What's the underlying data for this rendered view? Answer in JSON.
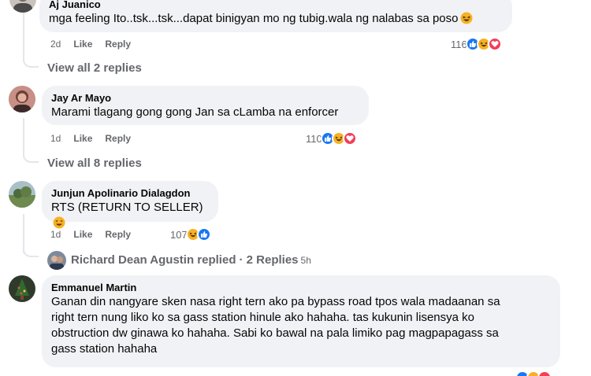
{
  "comments": [
    {
      "author": "Aj Juanico",
      "text": "mga feeling Ito..tsk...tsk...dapat binigyan mo ng tubig.wala ng nalabas sa poso",
      "time": "2d",
      "like_label": "Like",
      "reply_label": "Reply",
      "reaction_count": "116",
      "reactions": [
        "like-icon",
        "haha-icon",
        "love-icon"
      ],
      "view_replies": "View all 2 replies"
    },
    {
      "author": "Jay Ar Mayo",
      "text": "Marami tlagang gong gong Jan sa cLamba na enforcer",
      "time": "1d",
      "like_label": "Like",
      "reply_label": "Reply",
      "reaction_count": "110",
      "reactions": [
        "like-icon",
        "haha-icon",
        "love-icon"
      ],
      "view_replies": "View all 8 replies"
    },
    {
      "author": "Junjun Apolinario Dialagdon",
      "text": "RTS (RETURN TO SELLER)",
      "time": "1d",
      "like_label": "Like",
      "reply_label": "Reply",
      "reaction_count": "107",
      "reactions": [
        "haha-icon",
        "like-icon"
      ],
      "replied_by": "Richard Dean Agustin replied",
      "replied_count": "· 2 Replies",
      "replied_age": "5h"
    },
    {
      "author": "Emmanuel Martin",
      "text_lines": [
        "Ganan din nangyare sken nasa right tern ako pa bypass road tpos wala madaanan sa",
        "right tern nung liko ko sa gass station hinule ako hahaha. tas kukunin lisensya ko",
        "obstruction dw ginawa ko hahaha. Sabi ko bawal na pala limiko pag magpapagass sa",
        "gass station hahaha"
      ]
    }
  ],
  "colors": {
    "bubble": "#f0f2f5",
    "secondary_text": "#65676b",
    "like": "#1877f2",
    "haha": "#f7b125",
    "love": "#f33e58"
  }
}
